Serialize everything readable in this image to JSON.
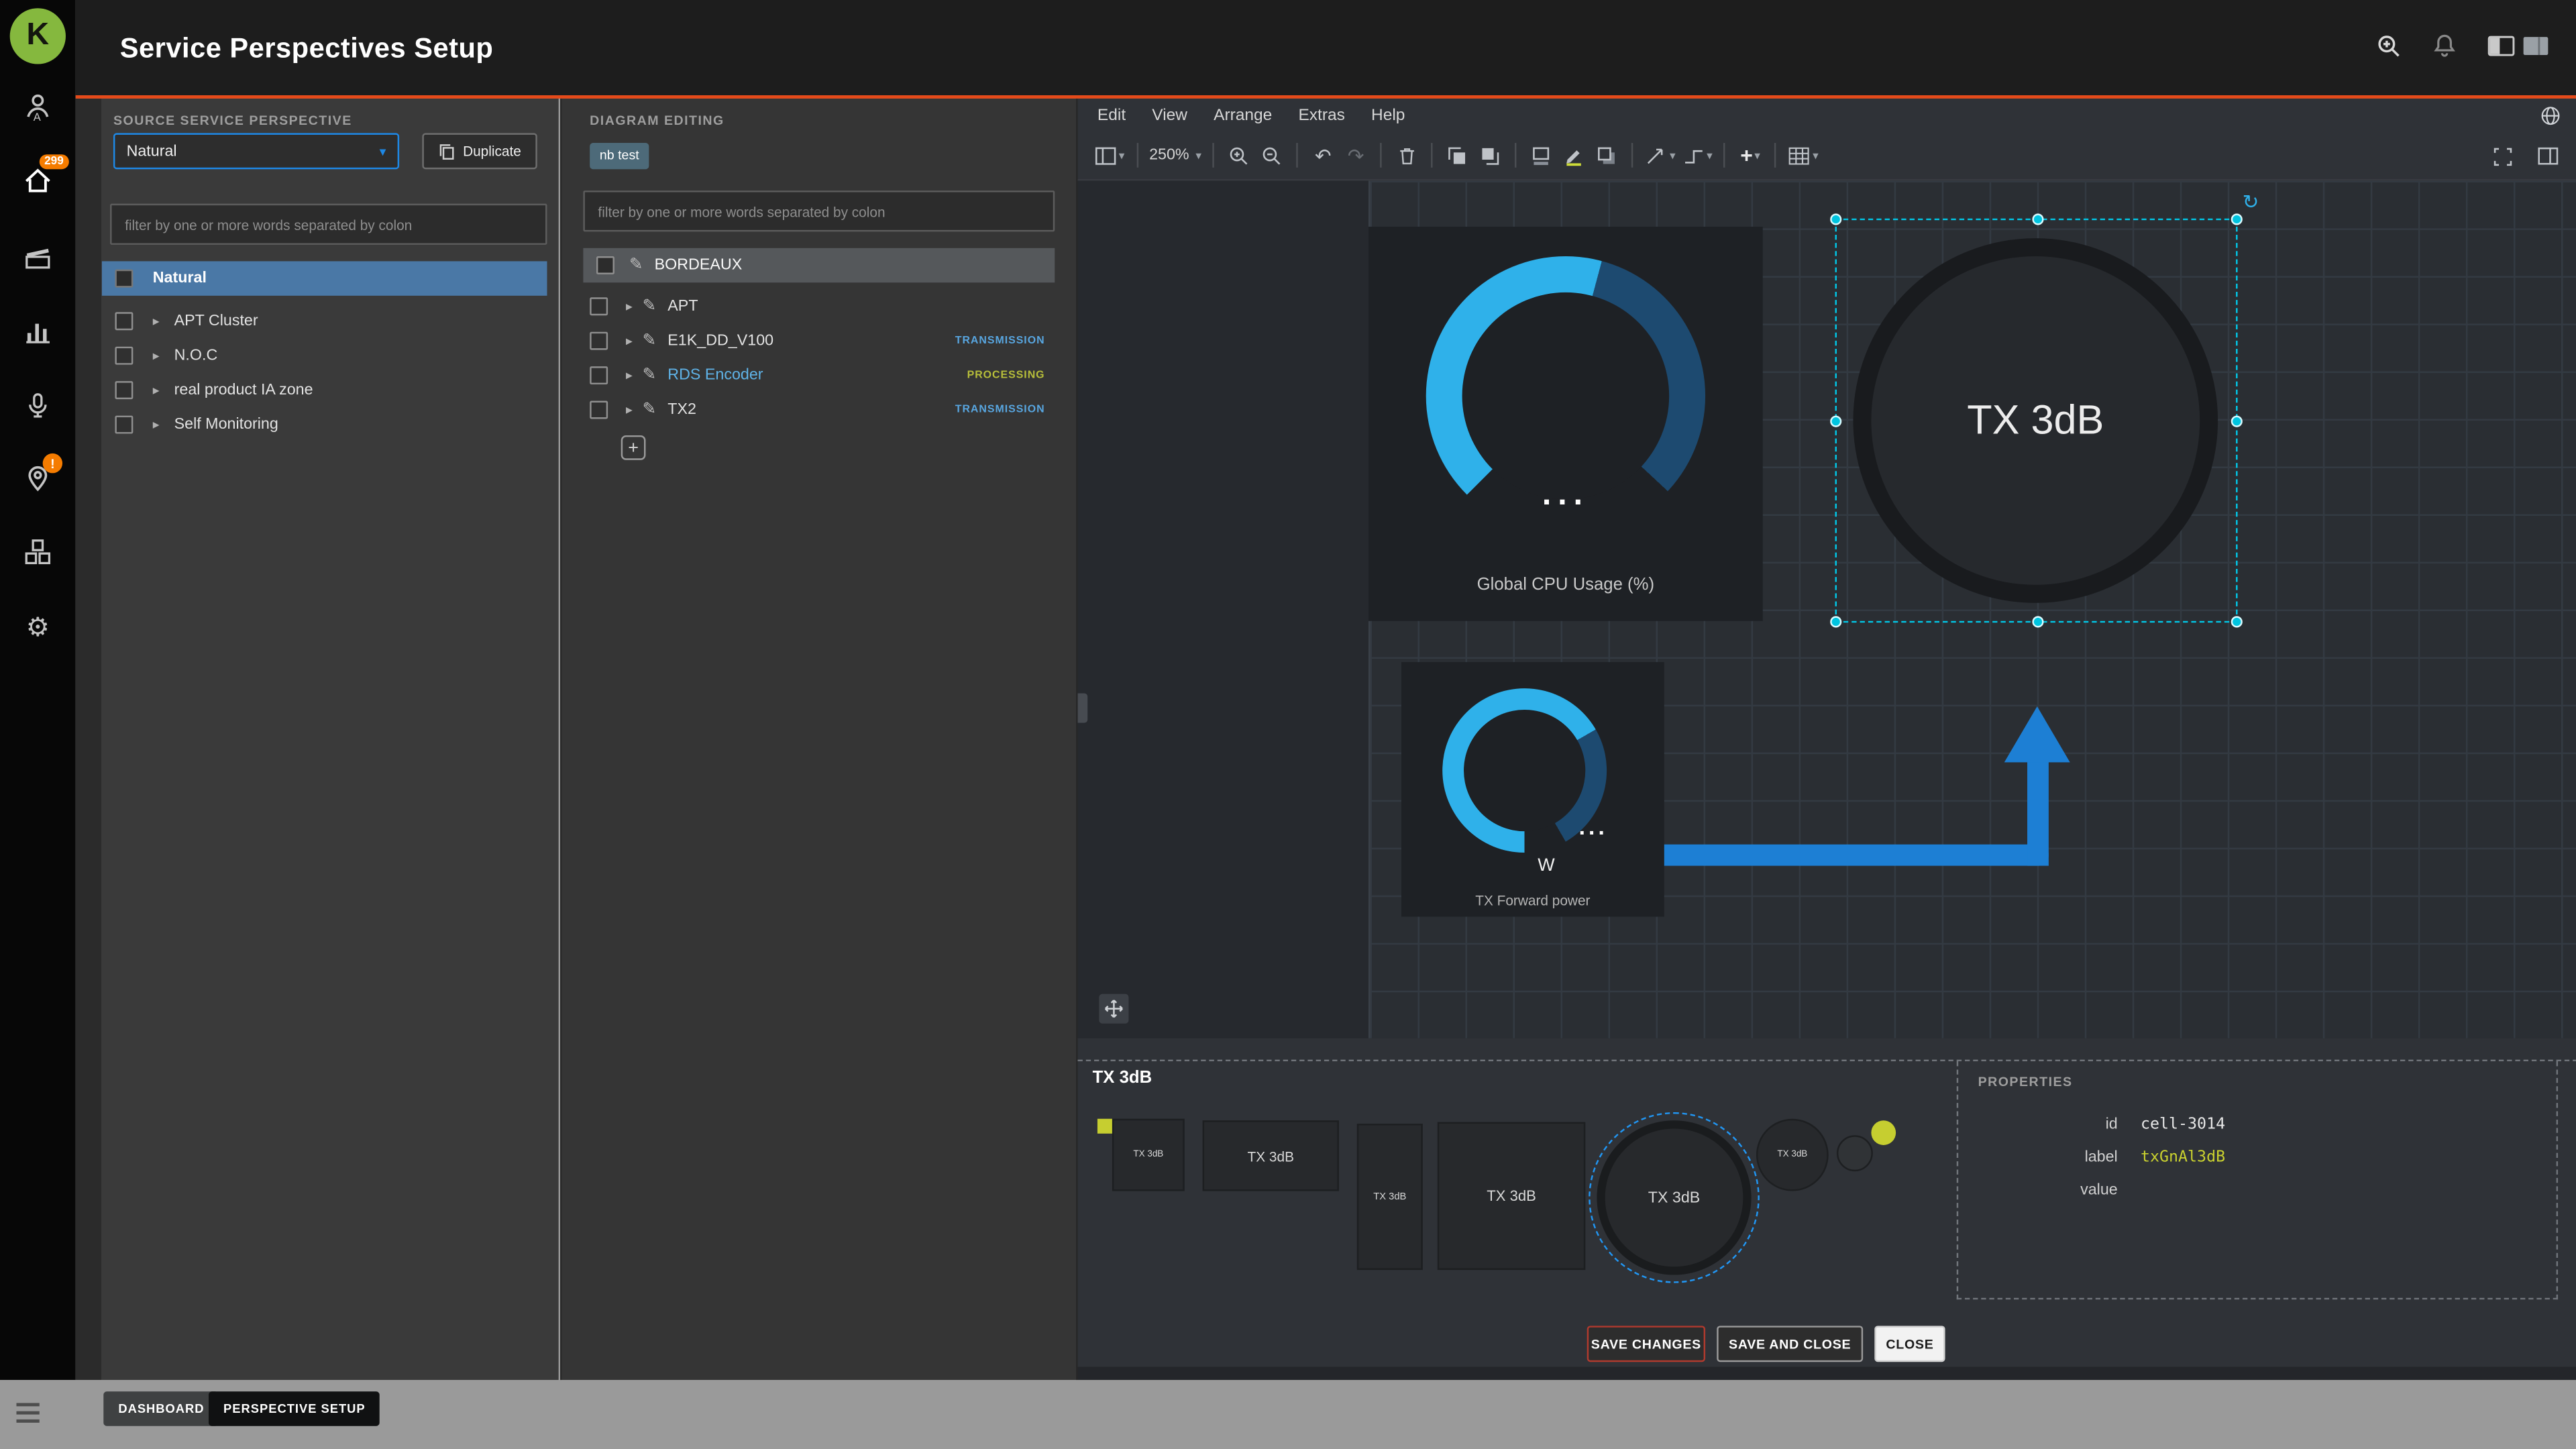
{
  "header": {
    "title": "Service Perspectives Setup"
  },
  "sidebar": {
    "logo_letter": "K",
    "badge_count": "299",
    "alert_badge": "!"
  },
  "source_panel": {
    "section_label": "SOURCE SERVICE PERSPECTIVE",
    "perspective_select": {
      "value": "Natural"
    },
    "duplicate_button": "Duplicate",
    "filter_placeholder": "filter by one or more words separated by colon",
    "tree": {
      "root": "Natural",
      "items": [
        {
          "label": "APT Cluster"
        },
        {
          "label": "N.O.C"
        },
        {
          "label": "real product IA zone"
        },
        {
          "label": "Self Monitoring"
        }
      ]
    }
  },
  "diagram_panel": {
    "section_label": "DIAGRAM EDITING",
    "diagram_chip": "nb test",
    "filter_placeholder": "filter by one or more words separated by colon",
    "tree": {
      "root": "BORDEAUX",
      "items": [
        {
          "label": "APT",
          "tag": ""
        },
        {
          "label": "E1K_DD_V100",
          "tag": "TRANSMISSION"
        },
        {
          "label": "RDS Encoder",
          "tag": "PROCESSING"
        },
        {
          "label": "TX2",
          "tag": "TRANSMISSION"
        }
      ]
    },
    "add_button": "+"
  },
  "editor": {
    "menubar": {
      "items": [
        "Edit",
        "View",
        "Arrange",
        "Extras",
        "Help"
      ]
    },
    "toolbar": {
      "zoom_level": "250%"
    },
    "canvas": {
      "cpu_widget": {
        "dots": "...",
        "label": "Global CPU Usage (%)"
      },
      "power_widget": {
        "dots": "...",
        "unit": "W",
        "label": "TX Forward power"
      },
      "selected_node": {
        "label": "TX 3dB"
      }
    }
  },
  "shape_editor": {
    "title": "TX 3dB",
    "shape_label": "TX 3dB",
    "properties": {
      "section_label": "PROPERTIES",
      "rows": [
        {
          "key": "id",
          "value": "cell-3014"
        },
        {
          "key": "label",
          "value": "txGnAl3dB"
        },
        {
          "key": "value",
          "value": ""
        }
      ]
    },
    "buttons": {
      "save": "SAVE CHANGES",
      "save_close": "SAVE AND CLOSE",
      "close": "CLOSE"
    }
  },
  "statusbar": {
    "tabs": [
      "DASHBOARD",
      "PERSPECTIVE SETUP"
    ]
  },
  "colors": {
    "accent_orange": "#e64a19",
    "gauge_blue": "#2fb1ea",
    "selection_cyan": "#00c4e0",
    "arrow_blue": "#1d7fd4",
    "tag_transmission": "#58a6e0",
    "tag_processing": "#b8bf3a",
    "value_yellow": "#c9d12f",
    "row_highlight_blue": "#4a78a6",
    "badge_orange": "#f57c00"
  }
}
